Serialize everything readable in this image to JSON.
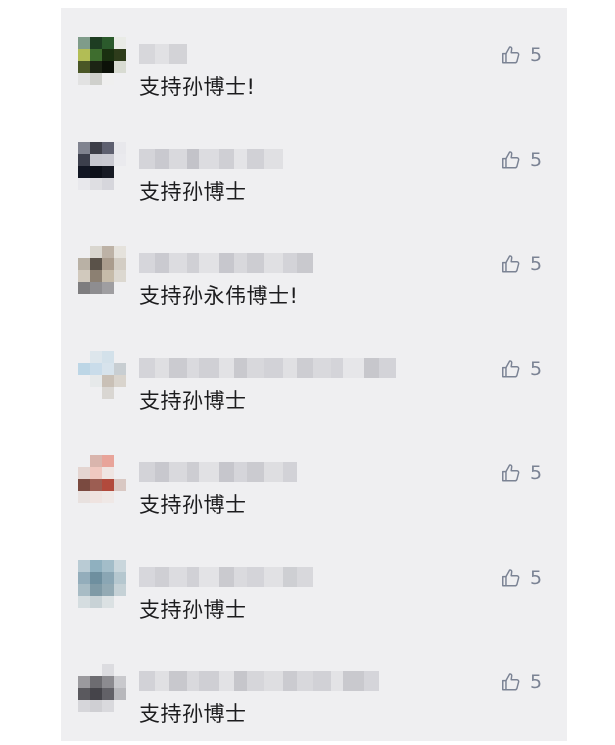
{
  "comments": [
    {
      "text": "支持孙博士!",
      "likes": "5",
      "avatar_pixels": [
        "#7f9c8a",
        "#1e3d22",
        "#2b5a2c",
        "#e9ebe6",
        "#b2bd55",
        "#3e6d2e",
        "#1a3010",
        "#2e3c1b",
        "#4a5626",
        "#1c2414",
        "#0c1108",
        "#d8dbd2",
        "#e2e2e2",
        "#cfd0cc",
        "#efefef",
        "#efeff1",
        "#efeff1",
        "#efeff1",
        "#efeff1",
        "#efeff1"
      ],
      "nick_blocks": [
        "#d7d7db",
        "#e1e1e4",
        "#d3d3d7"
      ]
    },
    {
      "text": "支持孙博士",
      "likes": "5",
      "avatar_pixels": [
        "#80838f",
        "#3d3e48",
        "#5e6070",
        "#e8e8ec",
        "#3c3f4c",
        "#c7c7cf",
        "#c9c9d1",
        "#eaeaee",
        "#121623",
        "#0d1019",
        "#171a24",
        "#efeff1",
        "#e8e8ec",
        "#dedee2",
        "#d6d6dc",
        "#efeff1",
        "#efeff1",
        "#efeff1",
        "#efeff1",
        "#efeff1"
      ],
      "nick_blocks": [
        "#d4d4d9",
        "#c9c9cf",
        "#d9d9dd",
        "#c3c3c9",
        "#dcdce0",
        "#cfcfd4",
        "#e4e4e7",
        "#d1d1d6",
        "#e0e0e3"
      ]
    },
    {
      "text": "支持孙永伟博士!",
      "likes": "5",
      "avatar_pixels": [
        "#efeff1",
        "#d9d6cf",
        "#bdb2a6",
        "#e5e2dc",
        "#b9b1a5",
        "#5a5249",
        "#aa9c8d",
        "#d3cdc4",
        "#d1c9bd",
        "#8c8072",
        "#c6bba9",
        "#dcd8d0",
        "#7e7d7f",
        "#8e8d90",
        "#9f9ea1",
        "#efeff1",
        "#efeff1",
        "#efeff1",
        "#efeff1",
        "#efeff1"
      ],
      "nick_blocks": [
        "#d6d6db",
        "#cacad0",
        "#dcdce0",
        "#d0d0d5",
        "#e2e2e5",
        "#c7c7cd",
        "#d8d8dc",
        "#cdcdd2",
        "#e0e0e3",
        "#d3d3d8",
        "#c9c9ce"
      ]
    },
    {
      "text": "支持孙博士",
      "likes": "5",
      "avatar_pixels": [
        "#efeff1",
        "#dde6ec",
        "#d3e1ea",
        "#efeff1",
        "#bdd6e6",
        "#c9dcea",
        "#d7e3ec",
        "#c8ced2",
        "#efeff1",
        "#e6e9ea",
        "#c9c0b6",
        "#d9d4cd",
        "#efeff1",
        "#efeff1",
        "#d9d6d2",
        "#efeff1",
        "#efeff1",
        "#efeff1",
        "#efeff1",
        "#efeff1"
      ],
      "nick_blocks": [
        "#d4d4d9",
        "#dfdfe2",
        "#cbcbd0",
        "#dadade",
        "#d0d0d5",
        "#e2e2e5",
        "#c9c9ce",
        "#d8d8dc",
        "#d2d2d7",
        "#e0e0e3",
        "#cdcdd2",
        "#d9d9dd",
        "#d4d4d9",
        "#e6e6e9",
        "#c7c7cc",
        "#d3d3d8"
      ]
    },
    {
      "text": "支持孙博士",
      "likes": "5",
      "avatar_pixels": [
        "#efeff1",
        "#d9b5ad",
        "#e8a49a",
        "#efeff1",
        "#e4d5d1",
        "#f0c8c0",
        "#efe5e2",
        "#efeff1",
        "#7a4a40",
        "#9c5d52",
        "#b24a3c",
        "#d9c8c3",
        "#e8e1df",
        "#efe3e0",
        "#efe8e6",
        "#efeff1",
        "#efeff1",
        "#efeff1",
        "#efeff1",
        "#efeff1"
      ],
      "nick_blocks": [
        "#d3d3d8",
        "#c8c8ce",
        "#d9d9dd",
        "#cdcdd2",
        "#e1e1e4",
        "#c6c6cc",
        "#d5d5da",
        "#cbcbd0",
        "#dedee1",
        "#d2d2d7"
      ]
    },
    {
      "text": "支持孙博士",
      "likes": "5",
      "avatar_pixels": [
        "#b9cbd4",
        "#8fb0bf",
        "#a3bdc9",
        "#c9d6dc",
        "#93adbb",
        "#6e8f9f",
        "#8aa6b4",
        "#b5c7cf",
        "#a8bcc5",
        "#7f9aa6",
        "#93aab4",
        "#c5d1d6",
        "#d5dde0",
        "#c8d2d6",
        "#dbe1e3",
        "#efeff1",
        "#efeff1",
        "#efeff1",
        "#efeff1",
        "#efeff1"
      ],
      "nick_blocks": [
        "#d7d7dc",
        "#cfcfd4",
        "#dcdce0",
        "#d1d1d6",
        "#e3e3e6",
        "#cacacf",
        "#dadade",
        "#d4d4d9",
        "#e1e1e4",
        "#cecfd3",
        "#d8d8dc"
      ]
    },
    {
      "text": "支持孙博士",
      "likes": "5",
      "avatar_pixels": [
        "#efeff1",
        "#efeff1",
        "#dcdce0",
        "#efeff1",
        "#9b9a9e",
        "#6d6c71",
        "#8c8b90",
        "#c9c9cd",
        "#5a595e",
        "#45444a",
        "#626167",
        "#b8b8bc",
        "#d6d6da",
        "#cfcfd3",
        "#d9d9dd",
        "#efeff1",
        "#efeff1",
        "#efeff1",
        "#efeff1",
        "#efeff1"
      ],
      "nick_blocks": [
        "#d2d2d7",
        "#e0e0e3",
        "#c8c8cd",
        "#d9d9dd",
        "#cfcfd4",
        "#e2e2e5",
        "#c6c6cb",
        "#d6d6da",
        "#dedee1",
        "#cbcbd0",
        "#d8d8dc",
        "#d1d1d6",
        "#e3e3e6",
        "#c9c9ce",
        "#d5d5da"
      ]
    }
  ]
}
